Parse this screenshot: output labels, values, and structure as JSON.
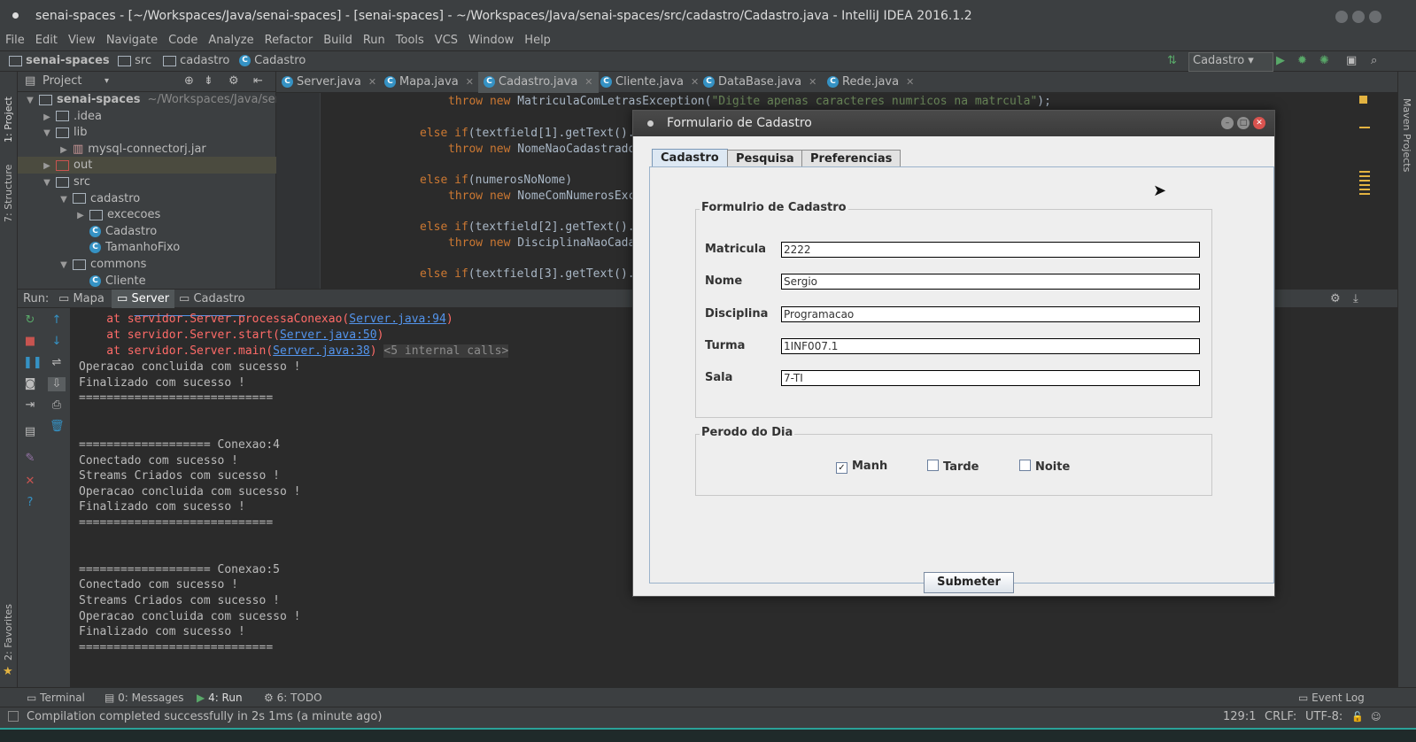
{
  "window": {
    "title": "senai-spaces - [~/Workspaces/Java/senai-spaces] - [senai-spaces] - ~/Workspaces/Java/senai-spaces/src/cadastro/Cadastro.java - IntelliJ IDEA 2016.1.2"
  },
  "menu": [
    "File",
    "Edit",
    "View",
    "Navigate",
    "Code",
    "Analyze",
    "Refactor",
    "Build",
    "Run",
    "Tools",
    "VCS",
    "Window",
    "Help"
  ],
  "breadcrumb": [
    "senai-spaces",
    "src",
    "cadastro",
    "Cadastro"
  ],
  "run_config": "Cadastro",
  "left_strip": {
    "project": "1: Project",
    "structure": "7: Structure",
    "favorites": "2: Favorites"
  },
  "right_strip": {
    "maven": "Maven Projects"
  },
  "project_panel": {
    "title": "Project",
    "tree": [
      {
        "label": "senai-spaces",
        "extra": "~/Workspaces/Java/senai",
        "kind": "module",
        "indent": 0,
        "arrow": "▼"
      },
      {
        "label": ".idea",
        "kind": "folder",
        "indent": 1,
        "arrow": "▶"
      },
      {
        "label": "lib",
        "kind": "folder",
        "indent": 1,
        "arrow": "▼"
      },
      {
        "label": "mysql-connectorj.jar",
        "kind": "jar",
        "indent": 2,
        "arrow": "▶"
      },
      {
        "label": "out",
        "kind": "folder-red",
        "indent": 1,
        "arrow": "▶"
      },
      {
        "label": "src",
        "kind": "folder",
        "indent": 1,
        "arrow": "▼"
      },
      {
        "label": "cadastro",
        "kind": "package",
        "indent": 2,
        "arrow": "▼"
      },
      {
        "label": "excecoes",
        "kind": "package",
        "indent": 3,
        "arrow": "▶"
      },
      {
        "label": "Cadastro",
        "kind": "class",
        "indent": 3,
        "arrow": ""
      },
      {
        "label": "TamanhoFixo",
        "kind": "class",
        "indent": 3,
        "arrow": ""
      },
      {
        "label": "commons",
        "kind": "package",
        "indent": 2,
        "arrow": "▼"
      },
      {
        "label": "Cliente",
        "kind": "class",
        "indent": 3,
        "arrow": ""
      }
    ]
  },
  "editor_tabs": [
    {
      "label": "Server.java",
      "active": false
    },
    {
      "label": "Mapa.java",
      "active": false
    },
    {
      "label": "Cadastro.java",
      "active": true
    },
    {
      "label": "Cliente.java",
      "active": false
    },
    {
      "label": "DataBase.java",
      "active": false
    },
    {
      "label": "Rede.java",
      "active": false
    }
  ],
  "code": {
    "l1_kw": "throw new ",
    "l1_rest": "MatriculaComLetrasException(",
    "l1_str": "\"Digite apenas caracteres numricos na matrcula\"",
    "l1_end": ");",
    "l2_kw": "else if",
    "l2_rest": "(textfield[1].getText().",
    "l3_kw": "throw new ",
    "l3_rest": "NomeNaoCadastrado",
    "l4_kw": "else if",
    "l4_rest": "(numerosNoNome)",
    "l5_kw": "throw new ",
    "l5_rest": "NomeComNumerosExc",
    "l6_kw": "else if",
    "l6_rest": "(textfield[2].getText().",
    "l7_kw": "throw new ",
    "l7_rest": "DisciplinaNaoCada",
    "l8_kw": "else if",
    "l8_rest": "(textfield[3].getText()."
  },
  "run_panel": {
    "label": "Run:",
    "tabs": [
      "Mapa",
      "Server",
      "Cadastro"
    ],
    "active": "Server"
  },
  "console": {
    "trace": [
      {
        "prefix": "    at servidor.Server.processaConexao(",
        "link": "Server.java:94",
        "suffix": ")"
      },
      {
        "prefix": "    at servidor.Server.start(",
        "link": "Server.java:50",
        "suffix": ")"
      },
      {
        "prefix": "    at servidor.Server.main(",
        "link": "Server.java:38",
        "suffix": ")",
        "folded": "<5 internal calls>"
      }
    ],
    "lines": [
      "Operacao concluida com sucesso !",
      "Finalizado com sucesso !",
      "============================",
      "",
      "",
      "=================== Conexao:4",
      "Conectado com sucesso !",
      "Streams Criados com sucesso !",
      "Operacao concluida com sucesso !",
      "Finalizado com sucesso !",
      "============================",
      "",
      "",
      "=================== Conexao:5",
      "Conectado com sucesso !",
      "Streams Criados com sucesso !",
      "Operacao concluida com sucesso !",
      "Finalizado com sucesso !",
      "============================"
    ]
  },
  "bottom_tabs": [
    {
      "label": "Terminal"
    },
    {
      "label": "0: Messages"
    },
    {
      "label": "4: Run"
    },
    {
      "label": "6: TODO"
    }
  ],
  "event_log": "Event Log",
  "status": {
    "message": "Compilation completed successfully in 2s 1ms (a minute ago)",
    "position": "129:1",
    "line_sep": "CRLF:",
    "encoding": "UTF-8:"
  },
  "dialog": {
    "title": "Formulario de Cadastro",
    "tabs": [
      {
        "label": "Cadastro",
        "active": true
      },
      {
        "label": "Pesquisa",
        "active": false
      },
      {
        "label": "Preferencias",
        "active": false
      }
    ],
    "form_group": "Formulrio de Cadastro",
    "fields": [
      {
        "label": "Matricula",
        "value": "2222"
      },
      {
        "label": "Nome",
        "value": "Sergio"
      },
      {
        "label": "Disciplina",
        "value": "Programacao"
      },
      {
        "label": "Turma",
        "value": "1INF007.1"
      },
      {
        "label": "Sala",
        "value": "7-TI"
      }
    ],
    "period_group": "Perodo do Dia",
    "periods": [
      {
        "label": "Manh",
        "checked": true
      },
      {
        "label": "Tarde",
        "checked": false
      },
      {
        "label": "Noite",
        "checked": false
      }
    ],
    "submit": "Submeter"
  }
}
